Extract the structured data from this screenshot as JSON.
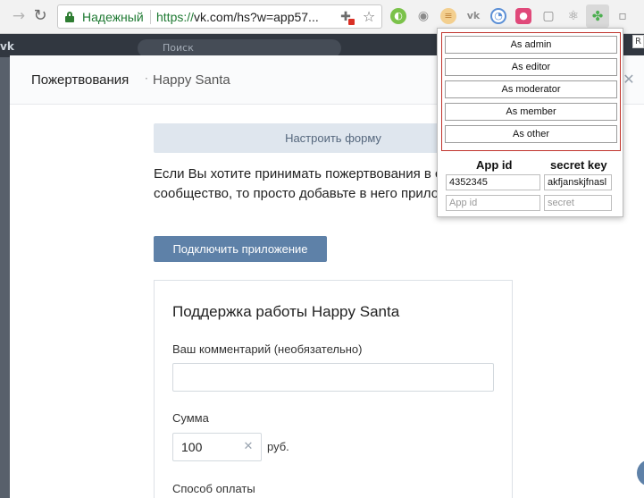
{
  "browser": {
    "secure_label": "Надежный",
    "url_scheme": "https://",
    "url_rest": "vk.com/hs?w=app57..."
  },
  "icons": {
    "forward": "arrow-right-icon",
    "reload": "reload-icon",
    "lock": "lock-icon",
    "extension_in_omnibox": "puzzle-icon",
    "bookmark": "star-icon",
    "active_extension": "clover-icon"
  },
  "extensions": [
    {
      "name": "evernote-icon",
      "glyph": "◐",
      "color": "#7bc24a"
    },
    {
      "name": "camera-icon",
      "glyph": "◉",
      "color": "#9a9a9a"
    },
    {
      "name": "burger-icon",
      "glyph": "≡",
      "color": "#e9b86b"
    },
    {
      "name": "vk-icon",
      "glyph": "vk",
      "color": "#8a8a8a"
    },
    {
      "name": "chart-icon",
      "glyph": "◔",
      "color": "#5b8fd6"
    },
    {
      "name": "record-icon",
      "glyph": "●",
      "color": "#e0497a"
    },
    {
      "name": "chat-icon",
      "glyph": "▢",
      "color": "#b5b5b5"
    },
    {
      "name": "react-icon",
      "glyph": "⚛",
      "color": "#8a8a8a"
    },
    {
      "name": "clover-icon",
      "glyph": "✤",
      "color": "#4caf50"
    },
    {
      "name": "overflow-icon",
      "glyph": "▫",
      "color": "#b5b5b5"
    }
  ],
  "vk": {
    "search_placeholder": "Поиск"
  },
  "modal": {
    "breadcrumb_main": "Пожертвования",
    "breadcrumb_separator": "·",
    "breadcrumb_app": "Happy Santa",
    "setup_button": "Настроить форму",
    "description": "Если Вы хотите принимать пожертвования в свое сообщество, то просто добавьте в него приложение.",
    "connect_button": "Подключить приложение",
    "card": {
      "title": "Поддержка работы Happy Santa",
      "comment_label": "Ваш комментарий (необязательно)",
      "comment_value": "",
      "sum_label": "Сумма",
      "sum_value": "100",
      "currency": "руб.",
      "payment_label": "Способ оплаты"
    }
  },
  "popup": {
    "roles": [
      "As admin",
      "As editor",
      "As moderator",
      "As member",
      "As other"
    ],
    "app_id_header": "App id",
    "secret_key_header": "secret key",
    "rows": [
      {
        "app_id": "4352345",
        "secret": "akfjanskjfnasl"
      }
    ],
    "app_id_placeholder": "App id",
    "secret_placeholder": "secret"
  },
  "overflow_tooltip": "R"
}
